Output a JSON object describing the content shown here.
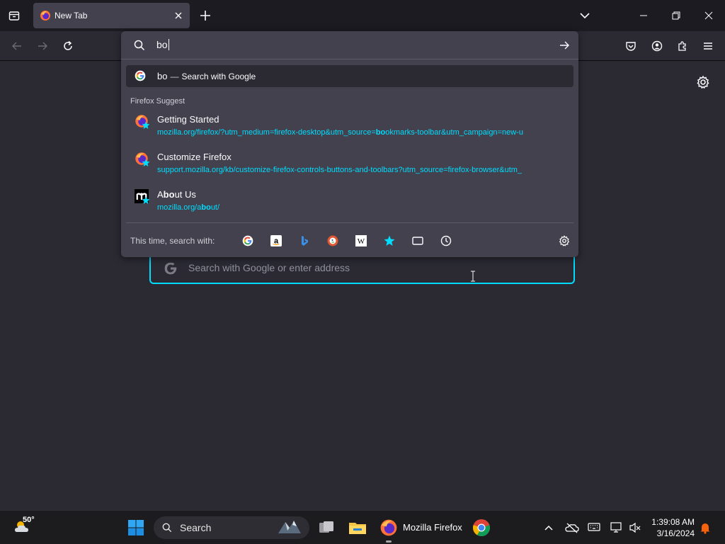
{
  "colors": {
    "accent": "#00ddff",
    "toolbar_bg": "#2b2a33",
    "tabstrip_bg": "#1c1b22",
    "popup_bg": "#42414d",
    "taskbar_bg": "#1c1c1f"
  },
  "tabs": [
    {
      "title": "New Tab",
      "icon": "firefox-icon",
      "active": true
    }
  ],
  "urlbar": {
    "typed_value": "bo",
    "search_engine_row": {
      "query": "bo",
      "separator": "—",
      "action": "Search with Google"
    },
    "group_label": "Firefox Suggest",
    "suggestions": [
      {
        "title_parts": [
          "Getting Started",
          "",
          ""
        ],
        "url_parts": [
          "mozilla.org/firefox/?utm_medium=firefox-desktop&utm_source=",
          "bo",
          "okmarks-toolbar&utm_campaign=new-u"
        ],
        "icon": "firefox-icon",
        "badge": "bookmark-star-icon"
      },
      {
        "title_parts": [
          "Customize Firefox",
          "",
          ""
        ],
        "url_parts": [
          "support.mozilla.org/kb/customize-firefox-controls-buttons-and-toolbars?utm_source=firefox-browser&utm_",
          "",
          ""
        ],
        "icon": "firefox-icon",
        "badge": "bookmark-star-icon"
      },
      {
        "title_parts": [
          "A",
          "bo",
          "ut Us"
        ],
        "url_parts": [
          "mozilla.org/a",
          "bo",
          "ut/"
        ],
        "icon": "mozilla-m-icon",
        "badge": "bookmark-star-icon"
      }
    ],
    "one_off_label": "This time, search with:",
    "one_off_engines": [
      "google-icon",
      "amazon-icon",
      "bing-icon",
      "duckduckgo-icon",
      "wikipedia-icon",
      "bookmarks-icon",
      "tabs-icon",
      "history-icon"
    ]
  },
  "newtab": {
    "search_placeholder": "Search with Google or enter address"
  },
  "taskbar": {
    "weather_temp": "50°",
    "search_label": "Search",
    "firefox_label": "Mozilla Firefox",
    "time": "1:39:08 AM",
    "date": "3/16/2024"
  }
}
